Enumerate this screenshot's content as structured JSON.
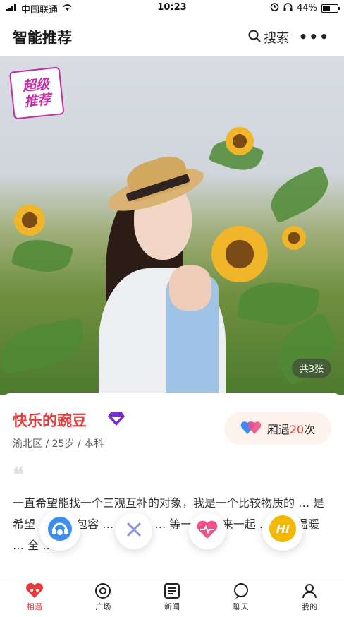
{
  "status_bar": {
    "carrier": "中国联通",
    "time": "10:23",
    "battery": "44%",
    "battery_level": 0.44
  },
  "header": {
    "title": "智能推荐",
    "search_label": "搜索",
    "more_glyph": "•••"
  },
  "photo": {
    "badge_line1": "超级",
    "badge_line2": "推荐",
    "photo_count": "共3张"
  },
  "profile": {
    "name": "快乐的豌豆",
    "meta": "渝北区 / 25岁 / 本科",
    "meet_prefix": "厢遇",
    "meet_count": "20",
    "meet_suffix": "次",
    "quote_glyph": "❝",
    "bio": "一直希望能找一个三观互补的对象，我是一个比较物质的 … 是希望 … 能够包容 … 成为一 … 等一个 … 来一起 … 活，温暖 … 全 …"
  },
  "actions": {
    "hi_label": "Hi"
  },
  "nav": {
    "items": [
      {
        "label": "相遇"
      },
      {
        "label": "广场"
      },
      {
        "label": "新闻"
      },
      {
        "label": "聊天"
      },
      {
        "label": "我的"
      }
    ]
  },
  "colors": {
    "accent": "#e83a3a",
    "purple": "#7b2bd6",
    "hi_yellow": "#f5b800"
  }
}
